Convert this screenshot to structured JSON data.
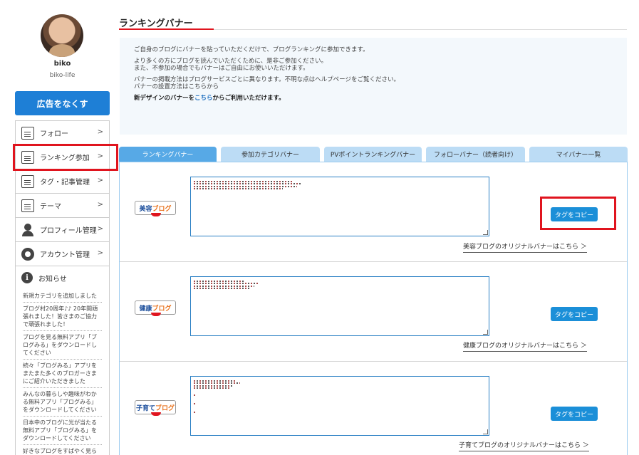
{
  "profile": {
    "username": "biko",
    "handle": "biko-life"
  },
  "sidebar": {
    "remove_ads": "広告をなくす",
    "items": [
      {
        "label": "フォロー",
        "icon": "follow-icon"
      },
      {
        "label": "ランキング参加",
        "icon": "ranking-icon"
      },
      {
        "label": "タグ・記事管理",
        "icon": "tag-icon"
      },
      {
        "label": "テーマ",
        "icon": "theme-icon"
      },
      {
        "label": "プロフィール管理",
        "icon": "profile-icon"
      },
      {
        "label": "アカウント管理",
        "icon": "gear-icon"
      }
    ],
    "chevron": ">",
    "news_title": "お知らせ",
    "news": [
      "新規カテゴリを追加しました",
      "ブログ村20周年♪♪ 20年間頑張れました！皆さまのご協力で頑張れました！",
      "ブログを見る無料アプリ「ブログみる」をダウンロードしてください",
      "続々「ブログみる」アプリをまたまた多くのブロガーさまにご紹介いただきました",
      "みんなの暮らしや趣味がわかる無料アプリ「ブログみる」をダウンロードしてください",
      "日本中のブログに光が当たる無料アプリ「ブログみる」をダウンロードしてください",
      "好きなブログをすばやく見られる無料アプリ「ブログみる」"
    ]
  },
  "main": {
    "title": "ランキングバナー",
    "intro": {
      "line1": "ご自身のブログにバナーを貼っていただくだけで、ブログランキングに参加できます。",
      "line2": "より多くの方にブログを読んでいただくために、是非ご参加ください。",
      "line3": "また、不参加の場合でもバナーはご自由にお使いいただけます。",
      "line4": "バナーの掲載方法はブログサービスごとに異なります。不明な点はヘルプページをご覧ください。",
      "line5": "バナーの設置方法はこちらから",
      "line6_prefix": "新デザインのバナーを",
      "line6_link": "こちら",
      "line6_suffix": "からご利用いただけます。"
    },
    "tabs": [
      "ランキングバナー",
      "参加カテゴリバナー",
      "PVポイントランキングバナー",
      "フォローバナー（読者向け）",
      "マイバナー一覧"
    ],
    "rows": [
      {
        "banner_a": "美容",
        "banner_b": "ブログ",
        "copy": "タグをコピー",
        "link": "美容ブログのオリジナルバナーはこちら ＞"
      },
      {
        "banner_a": "健康",
        "banner_b": "ブログ",
        "copy": "タグをコピー",
        "link": "健康ブログのオリジナルバナーはこちら ＞"
      },
      {
        "banner_a": "子育て",
        "banner_b": "ブログ",
        "copy": "タグをコピー",
        "link": "子育てブログのオリジナルバナーはこちら ＞"
      }
    ]
  },
  "colors": {
    "accent": "#1e7fd6",
    "highlight": "#e0141e",
    "tab_active": "#57a9e6",
    "tab_inactive": "#bcdcf5"
  }
}
